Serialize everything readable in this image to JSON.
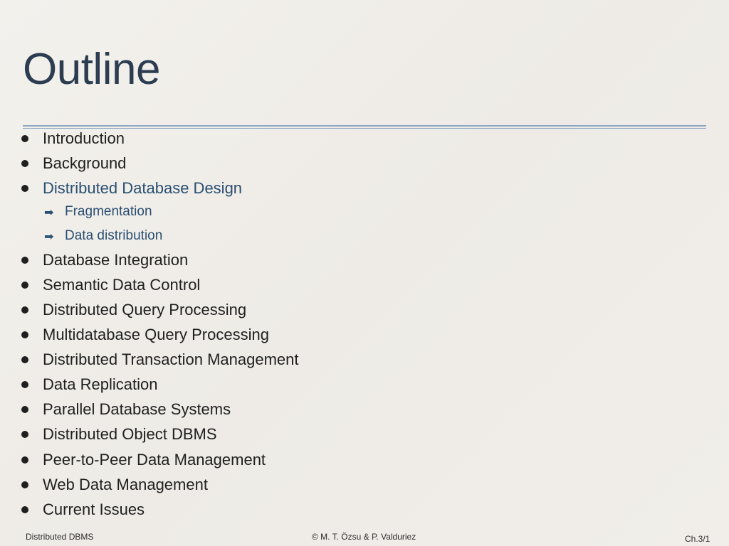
{
  "slide": {
    "title": "Outline",
    "items_top": [
      "Introduction",
      "Background",
      "Distributed Database Design"
    ],
    "subitems": [
      "Fragmentation",
      "Data distribution"
    ],
    "items_bottom": [
      "Database Integration",
      "Semantic Data Control",
      "Distributed Query Processing",
      "Multidatabase Query Processing",
      "Distributed Transaction Management",
      "Data Replication",
      "Parallel Database Systems",
      "Distributed Object DBMS",
      "Peer-to-Peer Data Management",
      "Web Data Management",
      "Current Issues"
    ],
    "highlight_item": "Distributed Database Design",
    "bullet_icon": "bullet-dot",
    "subitem_icon": "arrow-right-icon"
  },
  "footer": {
    "left": "Distributed DBMS",
    "center": "© M. T. Özsu & P. Valduriez",
    "right": "Ch.3/1"
  },
  "colors": {
    "title": "#2c3d51",
    "rule": "#8da6c4",
    "highlight": "#2a4e72",
    "text": "#1f1f1f",
    "background": "#efece7"
  }
}
